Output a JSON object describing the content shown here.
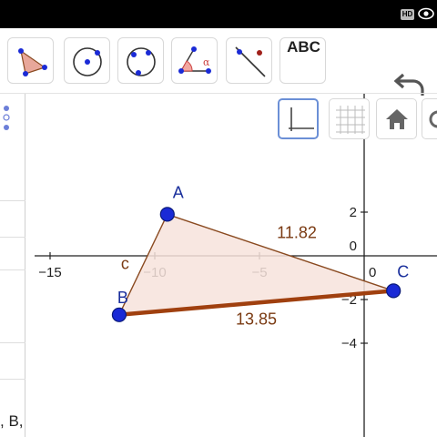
{
  "status_bar": {
    "hd_badge": "HD"
  },
  "toolbar": {
    "tools": [
      {
        "name": "polygon-tool",
        "icon": "polygon-icon"
      },
      {
        "name": "circle-center-point-tool",
        "icon": "circle-center-icon"
      },
      {
        "name": "circle-three-points-tool",
        "icon": "circle-three-points-icon"
      },
      {
        "name": "angle-tool",
        "icon": "angle-icon",
        "glyph": "α"
      },
      {
        "name": "line-tool",
        "icon": "line-icon"
      },
      {
        "name": "text-tool",
        "icon": "text-icon",
        "label": "ABC"
      }
    ],
    "undo_icon": "undo-icon"
  },
  "algebra_view": {
    "partial_text": ", B,"
  },
  "style_bar": {
    "buttons": [
      {
        "name": "axes-toggle",
        "icon": "axes-icon",
        "active": true
      },
      {
        "name": "grid-toggle",
        "icon": "grid-icon",
        "active": false
      },
      {
        "name": "home-button",
        "icon": "home-icon",
        "active": false
      },
      {
        "name": "more-button",
        "icon": "circle-icon",
        "active": false
      }
    ]
  },
  "graph": {
    "x_ticks": [
      {
        "value": -15,
        "label": "−15"
      },
      {
        "value": -10,
        "label": "−10"
      },
      {
        "value": -5,
        "label": "−5"
      },
      {
        "value": 0,
        "label": "0"
      }
    ],
    "y_ticks": [
      {
        "value": 2,
        "label": "2"
      },
      {
        "value": -2,
        "label": "−2"
      },
      {
        "value": -4,
        "label": "−4"
      }
    ],
    "origin_label": "0",
    "points": [
      {
        "id": "A",
        "label": "A",
        "x": -9.4,
        "y": 1.9
      },
      {
        "id": "B",
        "label": "B",
        "x": -11.7,
        "y": -2.7
      },
      {
        "id": "C",
        "label": "C",
        "x": 1.4,
        "y": -1.6
      }
    ],
    "segments": [
      {
        "id": "a",
        "label": "13.85",
        "from": "B",
        "to": "C",
        "highlighted": true
      },
      {
        "id": "b",
        "label": "11.82",
        "from": "A",
        "to": "C",
        "highlighted": false
      },
      {
        "id": "c",
        "label": "c",
        "from": "A",
        "to": "B",
        "highlighted": false
      }
    ],
    "colors": {
      "point": "#1a2ad6",
      "segment": "#8a4a20",
      "segment_highlight": "#a0400f",
      "fill": "#f7e3dc",
      "label": "#7a3a12",
      "point_label": "#1a2f9c"
    }
  }
}
